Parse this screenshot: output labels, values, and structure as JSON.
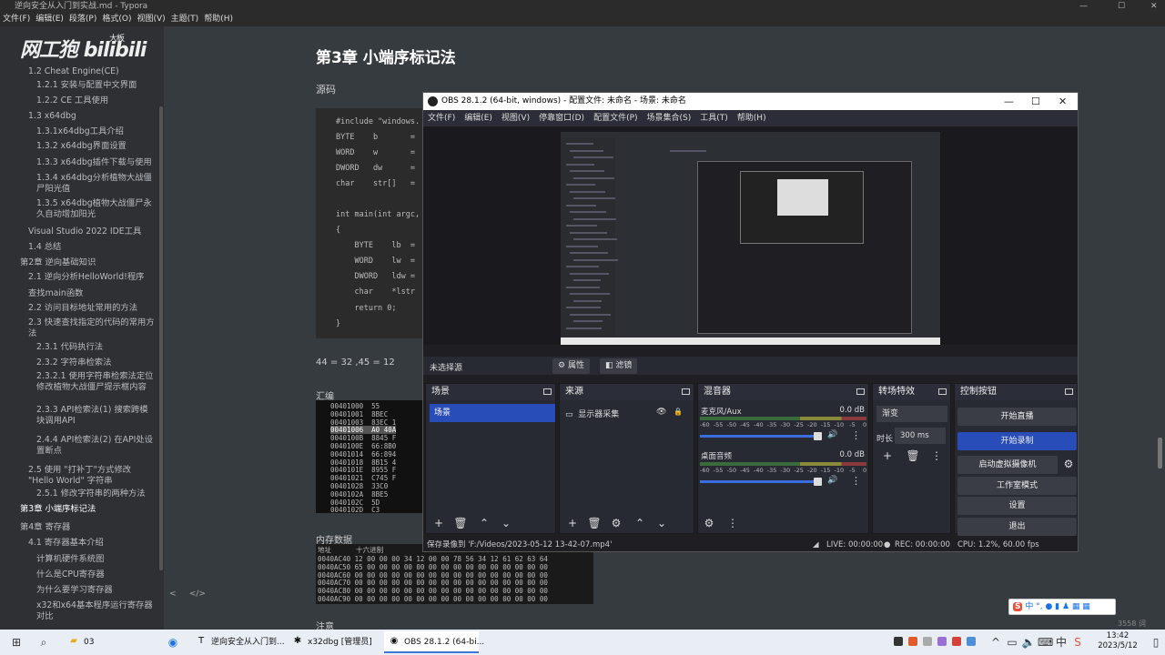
{
  "typora": {
    "title": "逆向安全从入门到实战.md - Typora",
    "menu": [
      "文件(F)",
      "编辑(E)",
      "段落(P)",
      "格式(O)",
      "视图(V)",
      "主题(T)",
      "帮助(H)"
    ],
    "logo": "网工狍",
    "logo_sub": "bilibili",
    "logo_small": "大板",
    "toc": [
      {
        "label": "1.2 Cheat Engine(CE)",
        "level": 2
      },
      {
        "label": "1.2.1 安装与配置中文界面",
        "level": 3
      },
      {
        "label": "1.2.2 CE 工具使用",
        "level": 3
      },
      {
        "label": "1.3 x64dbg",
        "level": 2
      },
      {
        "label": "1.3.1x64dbg工具介绍",
        "level": 3
      },
      {
        "label": "1.3.2 x64dbg界面设置",
        "level": 3
      },
      {
        "label": "1.3.3 x64dbg插件下载与使用",
        "level": 3
      },
      {
        "label": "1.3.4 x64dbg分析植物大战僵尸阳光值",
        "level": 3
      },
      {
        "label": "1.3.5 x64dbg植物大战僵尸永久自动增加阳光",
        "level": 3
      },
      {
        "label": "Visual Studio 2022 IDE工具",
        "level": 2
      },
      {
        "label": "1.4 总结",
        "level": 2
      },
      {
        "label": "第2章 逆向基础知识",
        "level": 1
      },
      {
        "label": "2.1 逆向分析HelloWorld!程序",
        "level": 2
      },
      {
        "label": "查找main函数",
        "level": 2
      },
      {
        "label": "2.2 访问目标地址常用的方法",
        "level": 2
      },
      {
        "label": "2.3 快速查找指定的代码的常用方法",
        "level": 2
      },
      {
        "label": "2.3.1 代码执行法",
        "level": 3
      },
      {
        "label": "2.3.2 字符串检索法",
        "level": 3
      },
      {
        "label": "2.3.2.1 使用字符串检索法定位修改植物大战僵尸提示框内容",
        "level": 3
      },
      {
        "label": "2.3.3 API检索法(1) 搜索跨模块调用API",
        "level": 3
      },
      {
        "label": "2.4.4 API检索法(2) 在API处设置断点",
        "level": 3
      },
      {
        "label": "2.5 使用 \"打补丁\"方式修改 \"Hello World\" 字符串",
        "level": 2
      },
      {
        "label": "2.5.1 修改字符串的两种方法",
        "level": 3
      },
      {
        "label": "第3章 小端序标记法",
        "level": 1
      },
      {
        "label": "第4章 寄存器",
        "level": 1
      },
      {
        "label": "4.1 寄存器基本介绍",
        "level": 2
      },
      {
        "label": "计算机硬件系统图",
        "level": 3
      },
      {
        "label": "什么是CPU寄存器",
        "level": 3
      },
      {
        "label": "为什么要学习寄存器",
        "level": 3
      },
      {
        "label": "x32和x64基本程序运行寄存器对比",
        "level": 3
      }
    ],
    "footer_icons": [
      "<",
      "</>"
    ],
    "heading": "第3章 小端序标记法",
    "source_label": "源码",
    "code_lines": [
      "#include \"windows.",
      "BYTE    b       =",
      "WORD    w       =",
      "DWORD   dw      =",
      "char    str[]   =",
      "",
      "int main(int argc,",
      "{",
      "    BYTE    lb  =",
      "    WORD    lw  =",
      "    DWORD   ldw =",
      "    char    *lstr",
      "",
      "    return 0;",
      "}"
    ],
    "equation": "44 = 32 ,45 = 12",
    "asm_label": "汇编",
    "asm_rows": [
      "00401000  55",
      "00401001  8BEC",
      "00401003  83EC 1",
      "00401006  A0 40A",
      "0040100B  8845 F",
      "0040100E  66:8B0",
      "00401014  66:894",
      "00401018  8B15 4",
      "0040101E  8955 F",
      "00401021  C745 F",
      "00401028  33C0",
      "0040102A  8BE5",
      "0040102C  5D",
      "0040102D  C3"
    ],
    "mem_label": "内存数据",
    "mem_header": "地址      十六进制",
    "mem_rows": [
      "0040AC40 12 00 00 00 34 12 00 00 78 56 34 12 61 62 63 64",
      "0040AC50 65 00 00 00 00 00 00 00 00 00 00 00 00 00 00 00",
      "0040AC60 00 00 00 00 00 00 00 00 00 00 00 00 00 00 00 00",
      "0040AC70 00 00 00 00 00 00 00 00 00 00 00 00 00 00 00 00",
      "0040AC80 00 00 00 00 00 00 00 00 00 00 00 00 00 00 00 00",
      "0040AC90 00 00 00 00 00 00 00 00 00 00 00 00 00 00 00 00"
    ],
    "note_label": "注意",
    "word_count": "3558 词"
  },
  "obs": {
    "title": "OBS 28.1.2 (64-bit, windows) - 配置文件: 未命名 - 场景: 未命名",
    "menu": [
      "文件(F)",
      "编辑(E)",
      "视图(V)",
      "停靠窗口(D)",
      "配置文件(P)",
      "场景集合(S)",
      "工具(T)",
      "帮助(H)"
    ],
    "no_source": "未选择源",
    "props_btn": "属性",
    "filters_btn": "滤镜",
    "docks": {
      "scenes": "场景",
      "sources": "来源",
      "mixer": "混音器",
      "transitions": "转场特效",
      "controls": "控制按钮"
    },
    "scene_item": "场景",
    "source_item": "显示器采集",
    "mixer": [
      {
        "name": "麦克风/Aux",
        "db": "0.0 dB",
        "level": 1.0
      },
      {
        "name": "桌面音频",
        "db": "0.0 dB",
        "level": 1.0
      }
    ],
    "meter_ticks": "-60  -55  -50  -45  -40  -35  -30  -25  -20  -15  -10   -5    0",
    "transition": "渐变",
    "duration_label": "时长",
    "duration": "300 ms",
    "controls": [
      "开始直播",
      "开始录制",
      "启动虚拟摄像机",
      "工作室模式",
      "设置",
      "退出"
    ],
    "status": {
      "saved": "保存录像到 'F:/Videos/2023-05-12 13-42-07.mp4'",
      "live": "LIVE: 00:00:00",
      "rec": "REC: 00:00:00",
      "cpu": "CPU: 1.2%, 60.00 fps"
    }
  },
  "ime": {
    "logo": "S",
    "text": "中 °, ● ▮ ♟ ▦ ▦"
  },
  "taskbar": {
    "apps": [
      {
        "label": "03",
        "icon": "folder-icon"
      },
      {
        "label": "逆向安全从入门到...",
        "icon": "typora-icon"
      },
      {
        "label": "x32dbg [管理员]",
        "icon": "bug-icon"
      },
      {
        "label": "OBS 28.1.2 (64-bi...",
        "icon": "obs-icon"
      }
    ],
    "time": "13:42",
    "date": "2023/5/12"
  }
}
